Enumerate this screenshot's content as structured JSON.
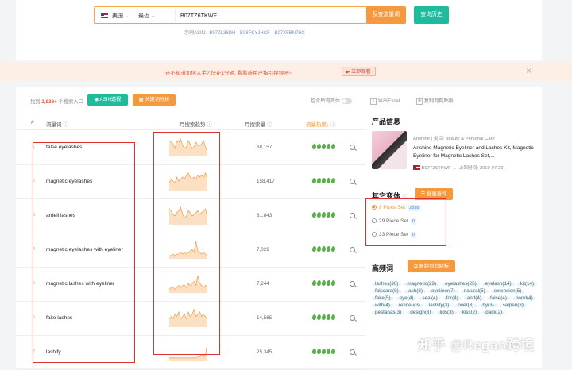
{
  "search": {
    "country": "美国",
    "sort": "最近",
    "query": "B07TZ6TKWF",
    "btn_query": "反查流量词",
    "btn_history": "查询历史",
    "examples_label": "示例ASIN:",
    "examples": [
      "B07ZL36DH",
      "B08FKYJHCF",
      "B07XFBN7HX"
    ]
  },
  "banner": {
    "text": "还不知道如何入手? 快花1分钟, 看看新用户指引视频吧~",
    "video_btn": "立即观看"
  },
  "toolbar": {
    "found_prefix": "找到",
    "found_count": "2,838+",
    "found_suffix": "个搜索入口",
    "asin_btn": "ASIN透视",
    "kw_btn": "关键词分析",
    "include_variants": "包含所有变体"
  },
  "table": {
    "headers": {
      "idx": "#",
      "keyword": "流量词",
      "trend": "月搜索趋势",
      "volume": "月搜索量",
      "heat": "流量热度"
    },
    "rows": [
      {
        "idx": "1",
        "keyword": "false eyelashes",
        "volume": "68,157",
        "spark": [
          9,
          8,
          7,
          4,
          9,
          8,
          10,
          6,
          4,
          5,
          9,
          7,
          4,
          5,
          8,
          6,
          6,
          7,
          9,
          5,
          2
        ]
      },
      {
        "idx": "2",
        "keyword": "magnetic eyelashes",
        "volume": "158,417",
        "spark": [
          3,
          5,
          4,
          3,
          6,
          4,
          5,
          6,
          5,
          7,
          8,
          6,
          5,
          6,
          5,
          7,
          6,
          7,
          6,
          8,
          5
        ]
      },
      {
        "idx": "3",
        "keyword": "ardell lashes",
        "volume": "31,843",
        "spark": [
          8,
          7,
          5,
          4,
          6,
          7,
          9,
          5,
          3,
          4,
          7,
          6,
          4,
          5,
          6,
          7,
          5,
          6,
          7,
          8,
          4
        ]
      },
      {
        "idx": "4",
        "keyword": "magnetic eyelashes with eyeliner",
        "volume": "7,029",
        "spark": [
          1,
          1,
          2,
          1,
          2,
          2,
          3,
          2,
          3,
          2,
          3,
          4,
          5,
          3,
          10,
          4,
          3,
          2,
          3,
          2,
          1
        ]
      },
      {
        "idx": "5",
        "keyword": "magnetic lashes with eyeliner",
        "volume": "7,244",
        "spark": [
          1,
          2,
          2,
          1,
          2,
          3,
          2,
          3,
          3,
          2,
          4,
          3,
          4,
          5,
          3,
          8,
          4,
          3,
          2,
          3,
          2
        ]
      },
      {
        "idx": "6",
        "keyword": "fake lashes",
        "volume": "14,565",
        "spark": [
          3,
          4,
          3,
          5,
          4,
          6,
          3,
          4,
          5,
          3,
          6,
          4,
          5,
          7,
          4,
          5,
          6,
          4,
          5,
          4,
          3
        ]
      },
      {
        "idx": "7",
        "keyword": "lashify",
        "volume": "25,345",
        "spark": [
          1,
          1,
          1,
          1,
          1,
          1,
          1,
          1,
          1,
          1,
          1,
          1,
          1,
          1,
          1,
          2,
          2,
          3,
          2,
          3,
          9
        ]
      }
    ]
  },
  "export": {
    "excel": "导出Excel",
    "copy": "复制到剪贴板"
  },
  "product": {
    "title": "产品信息",
    "brand": "Arishine",
    "category_label": "类目:",
    "category": "Beauty & Personal Care",
    "name": "Arishine Magnetic Eyeliner and Lashes Kit, Magnetic Eyeliner for Magnetic Lashes Set,...",
    "asin": "B07TZ6TKWF",
    "date_label": "上架时间:",
    "date": "2019-07-29"
  },
  "variants": {
    "title": "其它变体",
    "btn": "批量查询",
    "items": [
      {
        "label": "8 Piece Set",
        "count": "2838",
        "selected": true
      },
      {
        "label": "29 Piece Set",
        "count": "0",
        "selected": false
      },
      {
        "label": "33 Piece Set",
        "count": "0",
        "selected": false
      }
    ]
  },
  "freq": {
    "title": "高频词",
    "btn": "复制到剪贴板",
    "tags": [
      "lashes(30)",
      "magnetic(29)",
      "eyelashes(25)",
      "eyelash(14)",
      "kit(14)",
      "falscara(9)",
      "lash(8)",
      "eyeliner(7)",
      "natural(5)",
      "extension(5)",
      "fake(5)",
      "eye(4)",
      "seal(4)",
      "for(4)",
      "and(4)",
      "false(4)",
      "bond(4)",
      "with(4)",
      "refineu(3)",
      "lashify(3)",
      "over(3)",
      "by(3)",
      "salpeu(3)",
      "pestañas(3)",
      "design(3)",
      "lids(3)",
      "kiss(2)",
      "pack(2)"
    ]
  },
  "watermark": "知乎 @Regan跨境",
  "colors": {
    "accent": "#f59a3c",
    "teal": "#1cbc9c",
    "leaf": "#58b04a",
    "red_box": "#e0322c"
  }
}
